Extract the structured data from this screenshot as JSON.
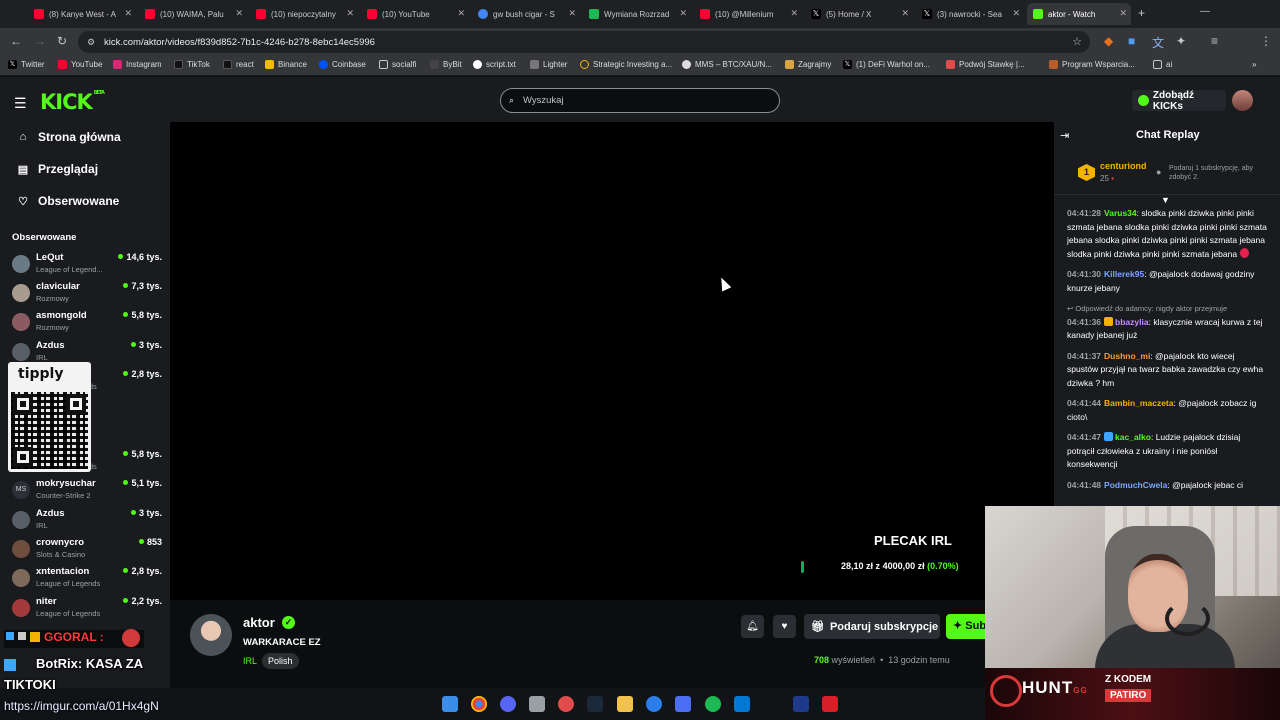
{
  "browser": {
    "tabs": [
      {
        "title": "(8) Kanye West - A",
        "color": "#ff0033"
      },
      {
        "title": "(10) WAIMA, Palu",
        "color": "#ff0033"
      },
      {
        "title": "(10) niepoczytalny",
        "color": "#ff0033"
      },
      {
        "title": "(10) YouTube",
        "color": "#ff0033"
      },
      {
        "title": "gw bush cigar - S",
        "color": "#4285f4"
      },
      {
        "title": "Wymiana Rozrzad",
        "color": "#1db954"
      },
      {
        "title": "(10) @Millenium",
        "color": "#ff0033"
      },
      {
        "title": "(5) Home / X",
        "color": "#ffffff"
      },
      {
        "title": "(3) nawrocki - Sea",
        "color": "#ffffff"
      },
      {
        "title": "aktor - Watch",
        "color": "#53fc18"
      }
    ],
    "url": "kick.com/aktor/videos/f839d852-7b1c-4246-b278-8ebc14ec5996",
    "bookmarks": [
      "Twitter",
      "YouTube",
      "Instagram",
      "TikTok",
      "react",
      "Binance",
      "Coinbase",
      "socialfi",
      "ByBit",
      "script.txt",
      "Lighter",
      "Strategic Investing a...",
      "MMS – BTC/XAU/N...",
      "Zagrajmy",
      "(1) DeFi Warhol on...",
      "Podwój Stawkę |...",
      "Program Wsparcia...",
      "ai"
    ]
  },
  "kick": {
    "logo": "KICK",
    "logo_beta": "BETA",
    "search_placeholder": "Wyszukaj",
    "kicks_button": "Zdobądź KICKs"
  },
  "sidebar": {
    "nav": [
      {
        "label": "Strona główna",
        "icon": "home-icon"
      },
      {
        "label": "Przeglądaj",
        "icon": "browse-icon"
      },
      {
        "label": "Obserwowane",
        "icon": "heart-icon"
      }
    ],
    "following_header": "Obserwowane",
    "following": [
      {
        "name": "LeQut",
        "category": "League of Legend...",
        "viewers": "14,6 tys.",
        "color": "#6b7a86"
      },
      {
        "name": "clavicular",
        "category": "Rozmowy",
        "viewers": "7,3 tys.",
        "color": "#a79c8f"
      },
      {
        "name": "asmongold",
        "category": "Rozmowy",
        "viewers": "5,8 tys.",
        "color": "#8c5b62"
      },
      {
        "name": "Azdus",
        "category": "IRL",
        "viewers": "3 tys.",
        "color": "#585f66"
      },
      {
        "name": "",
        "category": "Legends",
        "viewers": "2,8 tys.",
        "color": "#4a4f55"
      },
      {
        "name": "",
        "category": "Legends",
        "viewers": "5,8 tys.",
        "color": "#4a4f55"
      },
      {
        "name": "mokrysuchar",
        "category": "Counter-Strike 2",
        "viewers": "5,1 tys.",
        "color": "#2b3038"
      },
      {
        "name": "Azdus",
        "category": "IRL",
        "viewers": "3 tys.",
        "color": "#585f66"
      },
      {
        "name": "crownycro",
        "category": "Slots & Casino",
        "viewers": "853",
        "color": "#6e4e3d"
      },
      {
        "name": "xntentacion",
        "category": "League of Legends",
        "viewers": "2,8 tys.",
        "color": "#7d6a5a"
      },
      {
        "name": "niter",
        "category": "League of Legends",
        "viewers": "2,2 tys.",
        "color": "#a33a3a"
      }
    ]
  },
  "video": {
    "goal_title": "PLECAK IRL",
    "goal_current": "28,10 zł",
    "goal_sep": "z",
    "goal_target": "4000,00 zł",
    "goal_percent": "(0.70%)",
    "goal_fraction": 0.007
  },
  "stream": {
    "name": "aktor",
    "title": "WARKARACE EZ",
    "category": "IRL",
    "language": "Polish",
    "gift_label": "Podaruj subskrypcje",
    "sub_label": "Subskrybuj",
    "views_count": "708",
    "views_label": "wyświetleń",
    "ago": "13 godzin temu"
  },
  "chat": {
    "title": "Chat Replay",
    "gifter": {
      "rank": "1",
      "name": "centuriond",
      "count": "25",
      "note": "Podaruj 1 subskrypcję, aby zdobyć 2."
    },
    "messages": [
      {
        "time": "04:41:28",
        "user": "Varus34",
        "color": "#53fc18",
        "text": "slodka pinki dziwka pinki pinki szmata jebana slodka pinki dziwka pinki pinki szmata jebana slodka pinki dziwka pinki pinki szmata jebana slodka pinki dziwka pinki pinki szmata jebana"
      },
      {
        "time": "04:41:30",
        "user": "Killerek95",
        "color": "#7aa7ff",
        "text": "@pajalock dodawaj godziny knurze jebany"
      },
      {
        "reply": "Odpowiedź do adamcy: nigdy aktor przejmuje",
        "time": "04:41:36",
        "user": "bbazylia",
        "color": "#c58cff",
        "text": "klasycznie wracaj kurwa z tej kanady jebanej już"
      },
      {
        "time": "04:41:37",
        "user": "Dushno_mi",
        "color": "#ff9a3c",
        "text": "@pajalock kto wiecej spustów przyjął na twarz babka zawadzka czy ewha dziwka ? hm"
      },
      {
        "time": "04:41:44",
        "user": "Bambin_maczeta",
        "color": "#f2b400",
        "text": "@pajalock zobacz ig cioto\\"
      },
      {
        "time": "04:41:47",
        "user": "kac_alko",
        "color": "#53fc18",
        "text": "Ludzie pajalock dzisiaj potrącił człowieka z ukrainy i nie poniósł konsekwencji"
      },
      {
        "time": "04:41:48",
        "user": "PodmuchCwela",
        "color": "#7aa7ff",
        "text": "@pajalock jebac ci"
      }
    ]
  },
  "overlays": {
    "tipply": "tipply",
    "alert_goal": "GGORAL :",
    "alert_bot": "BotRix: KASA ZA",
    "alert_tiktok": "TIKTOKI",
    "imgur": "https://imgur.com/a/01Hx4gN",
    "hunt_brand": "HUNT",
    "hunt_gg": "GG",
    "hunt_code_label": "Z KODEM",
    "hunt_code": "PATIRO"
  }
}
